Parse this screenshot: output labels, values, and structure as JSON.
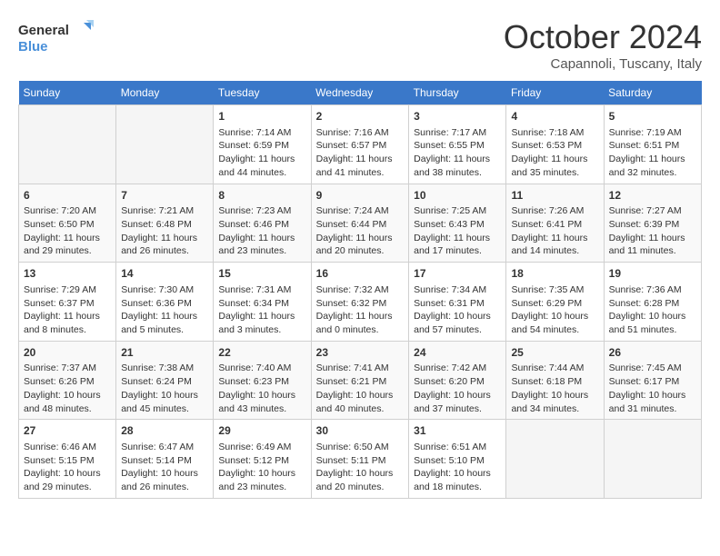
{
  "header": {
    "logo_line1": "General",
    "logo_line2": "Blue",
    "month": "October 2024",
    "location": "Capannoli, Tuscany, Italy"
  },
  "weekdays": [
    "Sunday",
    "Monday",
    "Tuesday",
    "Wednesday",
    "Thursday",
    "Friday",
    "Saturday"
  ],
  "weeks": [
    [
      {
        "day": "",
        "empty": true
      },
      {
        "day": "",
        "empty": true
      },
      {
        "day": "1",
        "sunrise": "Sunrise: 7:14 AM",
        "sunset": "Sunset: 6:59 PM",
        "daylight": "Daylight: 11 hours and 44 minutes."
      },
      {
        "day": "2",
        "sunrise": "Sunrise: 7:16 AM",
        "sunset": "Sunset: 6:57 PM",
        "daylight": "Daylight: 11 hours and 41 minutes."
      },
      {
        "day": "3",
        "sunrise": "Sunrise: 7:17 AM",
        "sunset": "Sunset: 6:55 PM",
        "daylight": "Daylight: 11 hours and 38 minutes."
      },
      {
        "day": "4",
        "sunrise": "Sunrise: 7:18 AM",
        "sunset": "Sunset: 6:53 PM",
        "daylight": "Daylight: 11 hours and 35 minutes."
      },
      {
        "day": "5",
        "sunrise": "Sunrise: 7:19 AM",
        "sunset": "Sunset: 6:51 PM",
        "daylight": "Daylight: 11 hours and 32 minutes."
      }
    ],
    [
      {
        "day": "6",
        "sunrise": "Sunrise: 7:20 AM",
        "sunset": "Sunset: 6:50 PM",
        "daylight": "Daylight: 11 hours and 29 minutes."
      },
      {
        "day": "7",
        "sunrise": "Sunrise: 7:21 AM",
        "sunset": "Sunset: 6:48 PM",
        "daylight": "Daylight: 11 hours and 26 minutes."
      },
      {
        "day": "8",
        "sunrise": "Sunrise: 7:23 AM",
        "sunset": "Sunset: 6:46 PM",
        "daylight": "Daylight: 11 hours and 23 minutes."
      },
      {
        "day": "9",
        "sunrise": "Sunrise: 7:24 AM",
        "sunset": "Sunset: 6:44 PM",
        "daylight": "Daylight: 11 hours and 20 minutes."
      },
      {
        "day": "10",
        "sunrise": "Sunrise: 7:25 AM",
        "sunset": "Sunset: 6:43 PM",
        "daylight": "Daylight: 11 hours and 17 minutes."
      },
      {
        "day": "11",
        "sunrise": "Sunrise: 7:26 AM",
        "sunset": "Sunset: 6:41 PM",
        "daylight": "Daylight: 11 hours and 14 minutes."
      },
      {
        "day": "12",
        "sunrise": "Sunrise: 7:27 AM",
        "sunset": "Sunset: 6:39 PM",
        "daylight": "Daylight: 11 hours and 11 minutes."
      }
    ],
    [
      {
        "day": "13",
        "sunrise": "Sunrise: 7:29 AM",
        "sunset": "Sunset: 6:37 PM",
        "daylight": "Daylight: 11 hours and 8 minutes."
      },
      {
        "day": "14",
        "sunrise": "Sunrise: 7:30 AM",
        "sunset": "Sunset: 6:36 PM",
        "daylight": "Daylight: 11 hours and 5 minutes."
      },
      {
        "day": "15",
        "sunrise": "Sunrise: 7:31 AM",
        "sunset": "Sunset: 6:34 PM",
        "daylight": "Daylight: 11 hours and 3 minutes."
      },
      {
        "day": "16",
        "sunrise": "Sunrise: 7:32 AM",
        "sunset": "Sunset: 6:32 PM",
        "daylight": "Daylight: 11 hours and 0 minutes."
      },
      {
        "day": "17",
        "sunrise": "Sunrise: 7:34 AM",
        "sunset": "Sunset: 6:31 PM",
        "daylight": "Daylight: 10 hours and 57 minutes."
      },
      {
        "day": "18",
        "sunrise": "Sunrise: 7:35 AM",
        "sunset": "Sunset: 6:29 PM",
        "daylight": "Daylight: 10 hours and 54 minutes."
      },
      {
        "day": "19",
        "sunrise": "Sunrise: 7:36 AM",
        "sunset": "Sunset: 6:28 PM",
        "daylight": "Daylight: 10 hours and 51 minutes."
      }
    ],
    [
      {
        "day": "20",
        "sunrise": "Sunrise: 7:37 AM",
        "sunset": "Sunset: 6:26 PM",
        "daylight": "Daylight: 10 hours and 48 minutes."
      },
      {
        "day": "21",
        "sunrise": "Sunrise: 7:38 AM",
        "sunset": "Sunset: 6:24 PM",
        "daylight": "Daylight: 10 hours and 45 minutes."
      },
      {
        "day": "22",
        "sunrise": "Sunrise: 7:40 AM",
        "sunset": "Sunset: 6:23 PM",
        "daylight": "Daylight: 10 hours and 43 minutes."
      },
      {
        "day": "23",
        "sunrise": "Sunrise: 7:41 AM",
        "sunset": "Sunset: 6:21 PM",
        "daylight": "Daylight: 10 hours and 40 minutes."
      },
      {
        "day": "24",
        "sunrise": "Sunrise: 7:42 AM",
        "sunset": "Sunset: 6:20 PM",
        "daylight": "Daylight: 10 hours and 37 minutes."
      },
      {
        "day": "25",
        "sunrise": "Sunrise: 7:44 AM",
        "sunset": "Sunset: 6:18 PM",
        "daylight": "Daylight: 10 hours and 34 minutes."
      },
      {
        "day": "26",
        "sunrise": "Sunrise: 7:45 AM",
        "sunset": "Sunset: 6:17 PM",
        "daylight": "Daylight: 10 hours and 31 minutes."
      }
    ],
    [
      {
        "day": "27",
        "sunrise": "Sunrise: 6:46 AM",
        "sunset": "Sunset: 5:15 PM",
        "daylight": "Daylight: 10 hours and 29 minutes."
      },
      {
        "day": "28",
        "sunrise": "Sunrise: 6:47 AM",
        "sunset": "Sunset: 5:14 PM",
        "daylight": "Daylight: 10 hours and 26 minutes."
      },
      {
        "day": "29",
        "sunrise": "Sunrise: 6:49 AM",
        "sunset": "Sunset: 5:12 PM",
        "daylight": "Daylight: 10 hours and 23 minutes."
      },
      {
        "day": "30",
        "sunrise": "Sunrise: 6:50 AM",
        "sunset": "Sunset: 5:11 PM",
        "daylight": "Daylight: 10 hours and 20 minutes."
      },
      {
        "day": "31",
        "sunrise": "Sunrise: 6:51 AM",
        "sunset": "Sunset: 5:10 PM",
        "daylight": "Daylight: 10 hours and 18 minutes."
      },
      {
        "day": "",
        "empty": true
      },
      {
        "day": "",
        "empty": true
      }
    ]
  ]
}
